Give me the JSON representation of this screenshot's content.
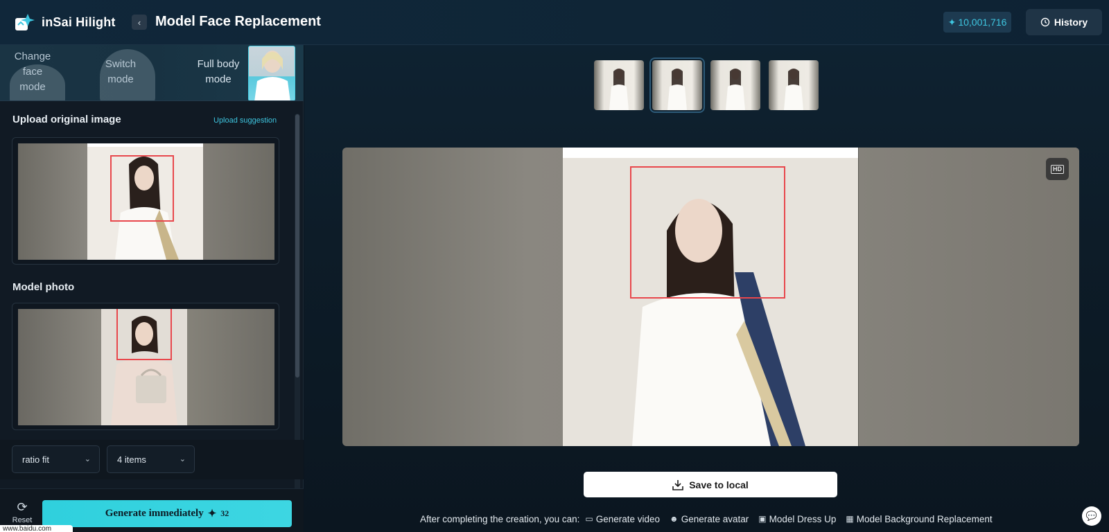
{
  "header": {
    "logo_text": "inSai Hilight",
    "back_icon": "chevron-left-icon",
    "title": "Model Face Replacement",
    "credits": "10,001,716",
    "history_label": "History"
  },
  "modes": {
    "change_face": "Change face mode",
    "switch": "Switch mode",
    "full_body": "Full body mode"
  },
  "sidebar": {
    "upload_title": "Upload original image",
    "upload_suggestion": "Upload suggestion",
    "model_title": "Model photo",
    "ratio_select": "ratio fit",
    "items_select": "4 items",
    "reset_label": "Reset",
    "generate_label": "Generate immediately",
    "generate_cost": "32",
    "url_hint": "www.baidu.com"
  },
  "main": {
    "hd_label": "HD",
    "save_label": "Save to local",
    "after_text": "After completing the creation, you can:",
    "actions": [
      "Generate video",
      "Generate avatar",
      "Model Dress Up",
      "Model Background Replacement"
    ]
  },
  "colors": {
    "accent": "#3ec6e0",
    "generate_bg": "#2fd0dd",
    "face_box": "#e8474c",
    "background": "#0b1520"
  }
}
